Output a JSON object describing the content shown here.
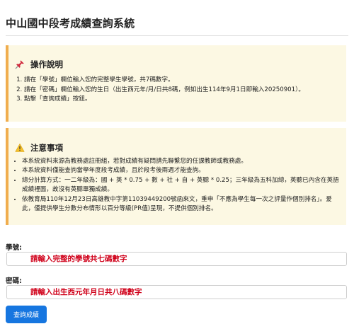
{
  "page": {
    "title": "中山國中段考成績查詢系統"
  },
  "instructions": {
    "icon": "pushpin-icon",
    "heading": "操作說明",
    "steps": [
      "請在「學號」欄位輸入您的完整學生學號，共7碼數字。",
      "請在「密碼」欄位輸入您的生日（出生西元年/月/日共8碼，例如出生114年9月1日即輸入20250901）。",
      "點擊「查詢成績」按鈕。"
    ]
  },
  "notes": {
    "icon": "warning-icon",
    "heading": "注意事項",
    "items": [
      "本系統資料來源為教務處註冊組，若對成績有疑問請先聯繫您的任課教師或教務處。",
      "本系統資料僅能查詢當學年度段考成績，且於段考後兩週才能查詢。",
      "總分計算方式：一二年級為：國 + 英 * 0.75 + 數 + 社 + 自 + 英聽 * 0.25；三年級為五科加總，英聽已內含在英語成績裡面，故沒有英聽單獨成績。",
      "依教育局110年12月23日高雄教中字第11039449200號函來文，重申「不應為學生每一次之評量作個別排名」。爰此，僅提供學生分數分布情形以百分等級(PR值)呈現，不提供個別排名。"
    ]
  },
  "form": {
    "student_id": {
      "label": "學號:",
      "placeholder": "請輸入完整的學號共七碼數字",
      "value": ""
    },
    "password": {
      "label": "密碼:",
      "placeholder": "請輸入出生西元年月日共八碼數字",
      "value": ""
    },
    "submit_label": "查詢成績"
  },
  "colors": {
    "panel_background": "#fcf8e3",
    "panel_accent": "#f0ad4e",
    "placeholder_text": "#d0021b",
    "button_background": "#1676e0"
  }
}
